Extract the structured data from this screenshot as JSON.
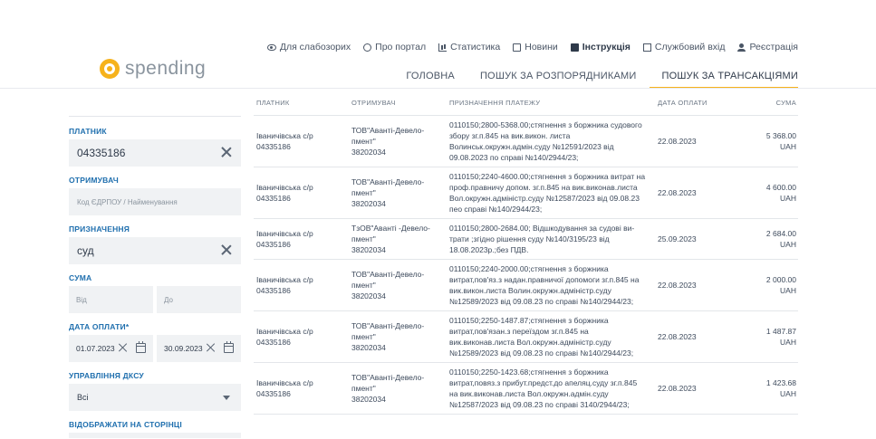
{
  "brand": {
    "name": "spending"
  },
  "top_nav": [
    {
      "label": "Для слабозорих",
      "icon": "eye-icon"
    },
    {
      "label": "Про портал",
      "icon": "info-icon"
    },
    {
      "label": "Статистика",
      "icon": "chart-icon"
    },
    {
      "label": "Новини",
      "icon": "news-icon"
    },
    {
      "label": "Інструкція",
      "icon": "book-icon"
    },
    {
      "label": "Службовий вхід",
      "icon": "login-icon"
    },
    {
      "label": "Реєстрація",
      "icon": "user-icon"
    }
  ],
  "main_nav": [
    {
      "label": "ГОЛОВНА"
    },
    {
      "label": "ПОШУК ЗА РОЗПОРЯДНИКАМИ"
    },
    {
      "label": "ПОШУК ЗА ТРАНСАКЦІЯМИ",
      "active": true
    }
  ],
  "filters": {
    "payer": {
      "label": "ПЛАТНИК",
      "value": "04335186"
    },
    "recipient": {
      "label": "ОТРИМУВАЧ",
      "placeholder": "Код ЄДРПОУ / Найменування"
    },
    "purpose": {
      "label": "ПРИЗНАЧЕННЯ",
      "value": "суд"
    },
    "amount": {
      "label": "СУМА",
      "from_placeholder": "Від",
      "to_placeholder": "До"
    },
    "payment_date": {
      "label": "ДАТА ОПЛАТИ*",
      "from": "01.07.2023",
      "to": "30.09.2023"
    },
    "dksu": {
      "label": "УПРАВЛІННЯ ДКСУ",
      "value": "Всі"
    },
    "per_page": {
      "label": "ВІДОБРАЖАТИ НА СТОРІНЦІ"
    }
  },
  "table": {
    "columns": [
      "ПЛАТНИК",
      "ОТРИМУВАЧ",
      "ПРИЗНАЧЕННЯ ПЛАТЕЖУ",
      "ДАТА ОПЛАТИ",
      "СУМА"
    ],
    "rows": [
      {
        "payer": [
          "Іваничівська с/р",
          "04335186"
        ],
        "recipient": [
          "ТОВ\"Аванті-Девело-",
          "пмент\"",
          "38202034"
        ],
        "purpose": [
          "0110150;2800-5368.00;стягнення з боржника судового",
          "збору зг.п.845 на вик.викон. листа",
          "Волинськ.окружн.адмін.суду №12591/2023 від",
          "09.08.2023 по справі №140/2944/23;"
        ],
        "date": "22.08.2023",
        "amount": "5 368.00",
        "currency": "UAH"
      },
      {
        "payer": [
          "Іваничівська с/р",
          "04335186"
        ],
        "recipient": [
          "ТОВ\"Аванті-Девело-",
          "пмент\"",
          "38202034"
        ],
        "purpose": [
          "0110150;2240-4600.00;стягнення з боржника витрат на",
          "проф.правничу допом. зг.п.845 на вик.виконав.листа",
          "Вол.окружн.адміністр.суду №12587/2023 від 09.08.23",
          "пео справі №140/2944/23;"
        ],
        "date": "22.08.2023",
        "amount": "4 600.00",
        "currency": "UAH"
      },
      {
        "payer": [
          "Іваничівська с/р",
          "04335186"
        ],
        "recipient": [
          "ТзОВ\"Аванті -Девело-",
          "пмент\"",
          "38202034"
        ],
        "purpose": [
          "0110150;2800-2684.00; Відшкодування за судові ви-",
          "трати ;згідно рішення суду №140/3195/23 від",
          "18.08.2023р.;без ПДВ."
        ],
        "date": "25.09.2023",
        "amount": "2 684.00",
        "currency": "UAH"
      },
      {
        "payer": [
          "Іваничівська с/р",
          "04335186"
        ],
        "recipient": [
          "ТОВ\"Аванті-Девело-",
          "пмент\"",
          "38202034"
        ],
        "purpose": [
          "0110150;2240-2000.00;стягнення з боржника",
          "витрат,пов'яз.з надан.правничої допомоги зг.п.845 на",
          "вик.викон.листа Волин.окружн.адміністр.суду",
          "№12589/2023 від 09.08.23 по справі №140/2944/23;"
        ],
        "date": "22.08.2023",
        "amount": "2 000.00",
        "currency": "UAH"
      },
      {
        "payer": [
          "Іваничівська с/р",
          "04335186"
        ],
        "recipient": [
          "ТОВ\"Аванті-Девело-",
          "пмент\"",
          "38202034"
        ],
        "purpose": [
          "0110150;2250-1487.87;стягнення з боржника",
          "витрат,пов'язан.з переїздом зг.п.845 на",
          "вик.виконав.листа Вол.окружн.адміністр.суду",
          "№12589/2023 від 09.08.23 по справі №140/2944/23;"
        ],
        "date": "22.08.2023",
        "amount": "1 487.87",
        "currency": "UAH"
      },
      {
        "payer": [
          "Іваничівська с/р",
          "04335186"
        ],
        "recipient": [
          "ТОВ\"Аванті-Девело-",
          "пмент\"",
          "38202034"
        ],
        "purpose": [
          "0110150;2250-1423.68;стягнення з боржника",
          "витрат,повяз.з прибут.предст.до апеляц.суду зг.п.845",
          "на вик.виконав.листа Вол.окружн.адмін.суду",
          "№12587/2023 від 09.08.23 по справі 3140/2944/23;"
        ],
        "date": "22.08.2023",
        "amount": "1 423.68",
        "currency": "UAH"
      }
    ]
  }
}
